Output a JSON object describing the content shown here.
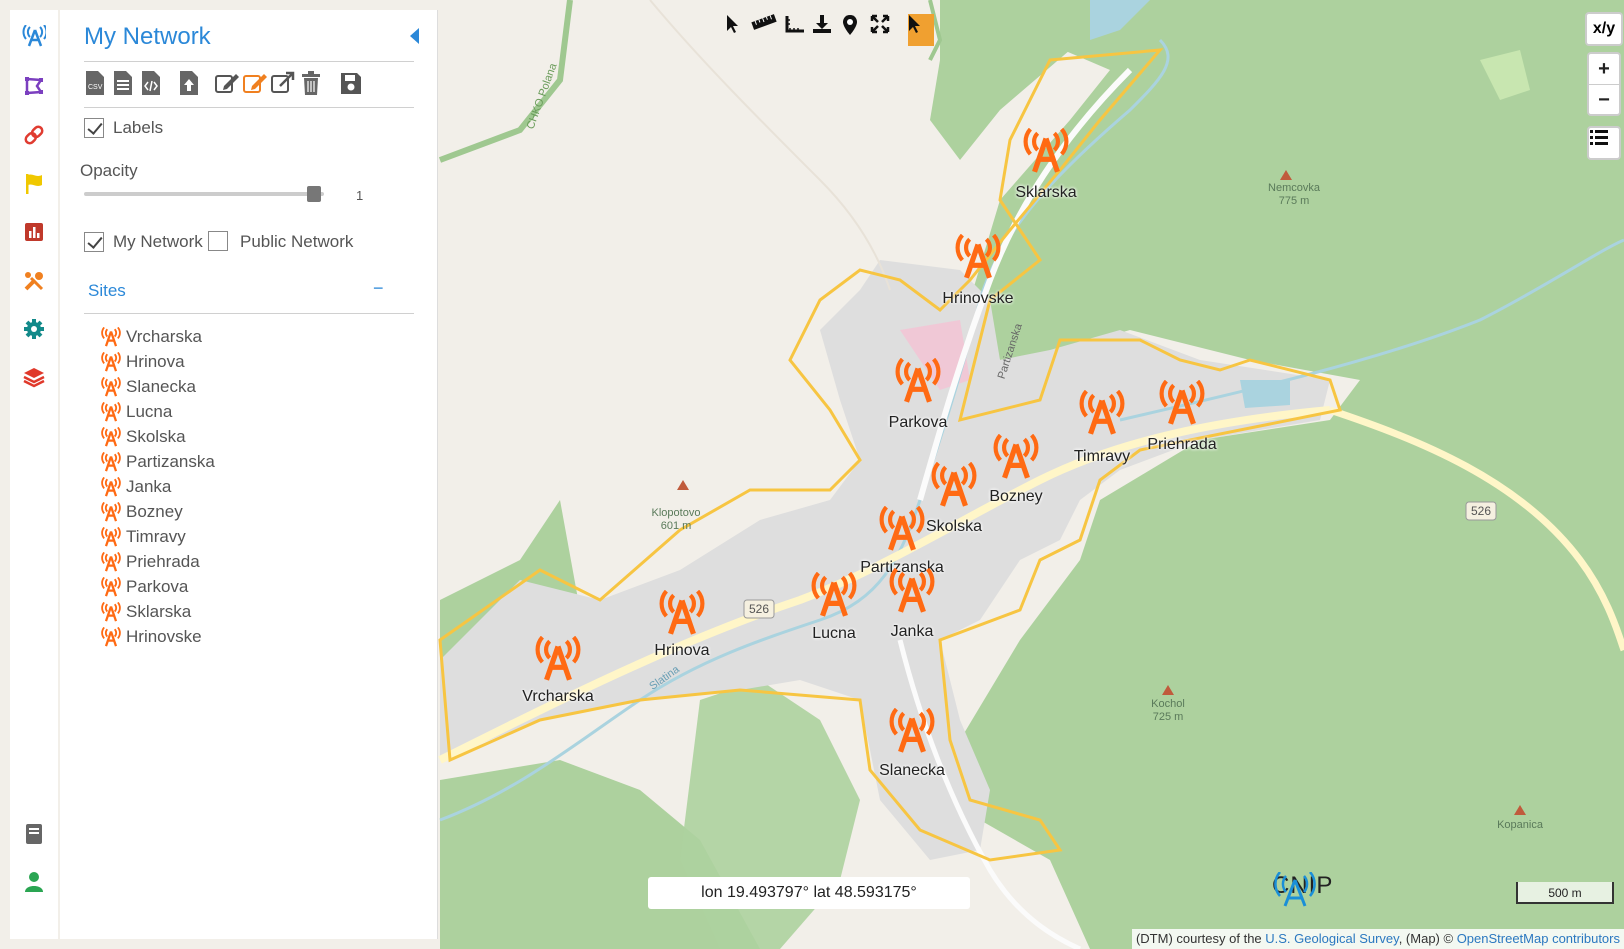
{
  "panel": {
    "title": "My Network",
    "labels_label": "Labels",
    "opacity_label": "Opacity",
    "opacity_value": "1",
    "opacity_fraction": 0.97,
    "my_network_label": "My Network",
    "public_network_label": "Public Network",
    "sites_label": "Sites",
    "sites_toggle": "−",
    "sites": [
      "Vrcharska",
      "Hrinova",
      "Slanecka",
      "Lucna",
      "Skolska",
      "Partizanska",
      "Janka",
      "Bozney",
      "Timravy",
      "Priehrada",
      "Parkova",
      "Sklarska",
      "Hrinovske"
    ]
  },
  "map": {
    "xy_label": "x/y",
    "zoom_in": "+",
    "zoom_out": "−",
    "coordinate_readout": "lon 19.493797° lat 48.593175°",
    "scale_label": "500 m",
    "logo_text": "CNIP",
    "attribution_prefix": "(DTM) courtesy of the ",
    "attribution_usgs": "U.S. Geological Survey",
    "attribution_mid": ", (Map) © ",
    "attribution_osm": "OpenStreetMap contributors",
    "markers": {
      "sklarska": "Sklarska",
      "hrinovske": "Hrinovske",
      "parkova": "Parkova",
      "timravy": "Timravy",
      "priehrada": "Priehrada",
      "bozney": "Bozney",
      "skolska": "Skolska",
      "partizanska": "Partizanska",
      "lucna": "Lucna",
      "janka": "Janka",
      "hrinova": "Hrinova",
      "vrcharska": "Vrcharska",
      "slanecka": "Slanecka"
    },
    "terrain_labels": {
      "nemcovka": "Nemcovka\n775 m",
      "klopotovo": "Klopotovo\n601 m",
      "kochol": "Kochol\n725 m",
      "kopanica": "Kopanica",
      "road_526_a": "526",
      "road_526_b": "526",
      "chko": "CHKO Polana",
      "slatina": "Slatina",
      "partizanska_street": "Partizanska"
    }
  },
  "colors": {
    "accent": "#2b88d8",
    "antenna": "#ff6a13",
    "boundary": "#f7c542",
    "forest": "#add19e",
    "urban": "#dddddd"
  }
}
